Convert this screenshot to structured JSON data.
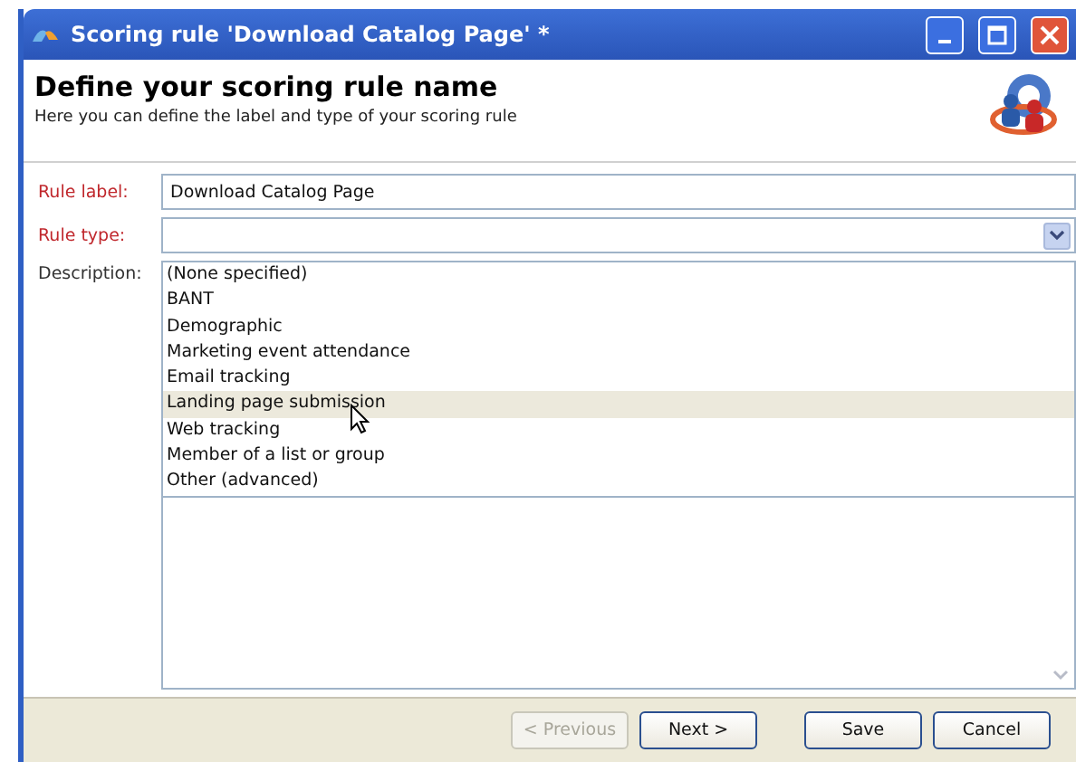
{
  "window": {
    "title": "Scoring rule 'Download Catalog Page' *"
  },
  "header": {
    "title": "Define your scoring rule name",
    "subtitle": "Here you can define the label and type of your scoring rule"
  },
  "form": {
    "rule_label": {
      "label": "Rule label:",
      "value": "Download Catalog Page"
    },
    "rule_type": {
      "label": "Rule type:"
    },
    "description": {
      "label": "Description:"
    }
  },
  "dropdown_options": [
    {
      "label": "(None specified)",
      "selected": false
    },
    {
      "label": "BANT",
      "selected": false
    },
    {
      "label": "Demographic",
      "selected": false
    },
    {
      "label": "Marketing event attendance",
      "selected": false
    },
    {
      "label": "Email tracking",
      "selected": false
    },
    {
      "label": "Landing page submission",
      "selected": true
    },
    {
      "label": "Web tracking",
      "selected": false
    },
    {
      "label": "Member of a list or group",
      "selected": false
    },
    {
      "label": "Other (advanced)",
      "selected": false
    }
  ],
  "buttons": [
    {
      "label": "< Previous",
      "disabled": true
    },
    {
      "label": "Next >",
      "disabled": false
    },
    {
      "label": "Save",
      "disabled": false
    },
    {
      "label": "Cancel",
      "disabled": false
    }
  ]
}
